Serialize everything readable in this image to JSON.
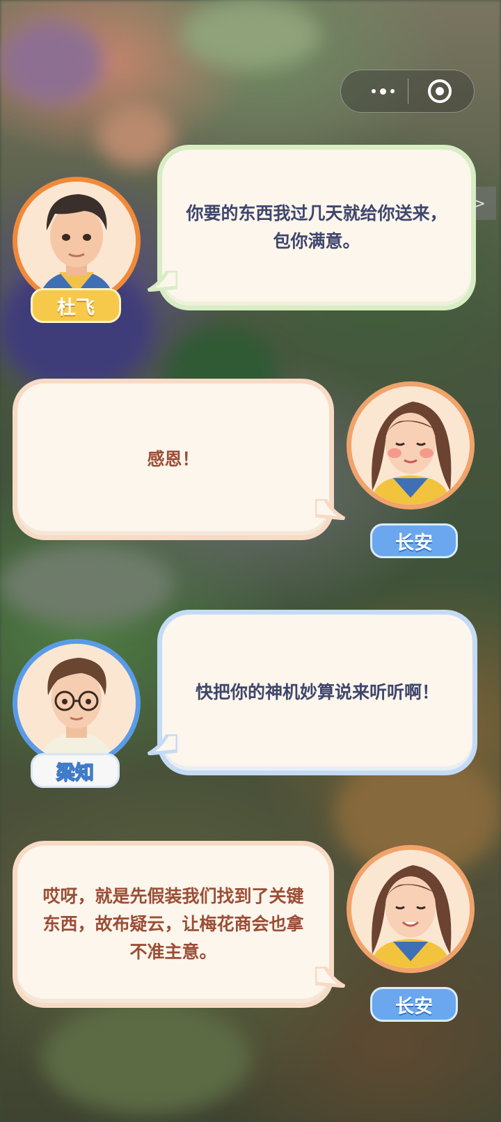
{
  "capsule": {
    "more_icon": "more-dots-icon",
    "close_icon": "target-close-icon"
  },
  "skip_label": ">>",
  "dialogues": [
    {
      "speaker": "杜飞",
      "text": "你要的东西我过几天就给你送来，包你满意。"
    },
    {
      "speaker": "长安",
      "text": "感恩！"
    },
    {
      "speaker": "梁知",
      "text": "快把你的神机妙算说来听听啊！"
    },
    {
      "speaker": "长安",
      "text": "哎呀，就是先假装我们找到了关键东西，故布疑云，让梅花商会也拿不准主意。"
    }
  ],
  "colors": {
    "bubble_fill": "#fdf6ec",
    "green_border": "#d8edc4",
    "blue_border": "#c4dbf5",
    "peach_border": "#f7dbc6"
  }
}
